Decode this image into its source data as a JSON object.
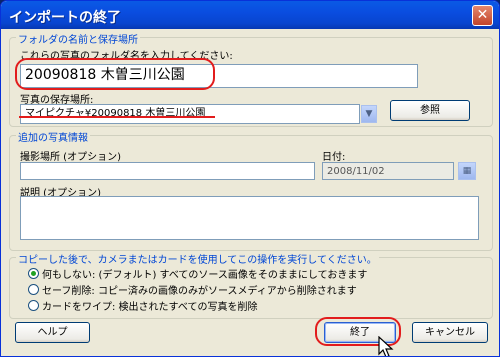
{
  "window": {
    "title": "インポートの終了",
    "close_glyph": "✕"
  },
  "folder_group": {
    "legend": "フォルダの名前と保存場所",
    "name_label": "これらの写真のフォルダ名を入力してください:",
    "name_value": "20090818 木曽三川公園",
    "location_label": "写真の保存場所:",
    "location_value": "マイピクチャ¥20090818 木曽三川公園",
    "browse_label": "参照"
  },
  "extra_group": {
    "legend": "追加の写真情報",
    "location_label": "撮影場所 (オプション)",
    "location_value": "",
    "date_label": "日付:",
    "date_value": "2008/11/02",
    "desc_label": "説明 (オプション)",
    "desc_value": ""
  },
  "after_group": {
    "legend": "コピーした後で、カメラまたはカードを使用してこの操作を実行してください。",
    "options": [
      {
        "label": "何もしない: (デフォルト) すべてのソース画像をそのままにしておきます",
        "selected": true
      },
      {
        "label": "セーフ削除: コピー済みの画像のみがソースメディアから削除されます",
        "selected": false
      },
      {
        "label": "カードをワイプ: 検出されたすべての写真を削除",
        "selected": false
      }
    ]
  },
  "buttons": {
    "help": "ヘルプ",
    "finish": "終了",
    "cancel": "キャンセル"
  },
  "colors": {
    "highlight": "#e21c1c",
    "title_bar": "#0a4de0",
    "legend_text": "#0046d5"
  }
}
